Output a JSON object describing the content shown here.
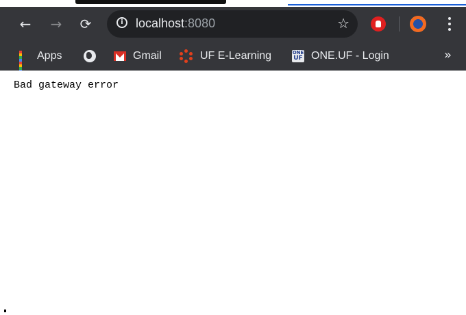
{
  "browser": {
    "address_bar": {
      "host": "localhost",
      "port": ":8080"
    },
    "icons": {
      "back": "back-arrow-icon",
      "forward": "forward-arrow-icon",
      "reload": "reload-icon",
      "info": "info-icon",
      "bookmark_star": "star-icon",
      "extension": "stop-hand-icon",
      "profile": "profile-avatar-icon",
      "menu": "kebab-menu-icon"
    },
    "bookmarks": {
      "items": [
        {
          "label": "Apps",
          "icon": "apps-grid-icon"
        },
        {
          "label": "",
          "icon": "globe-icon"
        },
        {
          "label": "Gmail",
          "icon": "gmail-icon"
        },
        {
          "label": "UF E-Learning",
          "icon": "canvas-icon"
        },
        {
          "label": "ONE.UF - Login",
          "icon": "one-uf-icon"
        }
      ],
      "overflow": "»",
      "oneuf_icon_text": [
        "ONE",
        "UF"
      ]
    },
    "colors": {
      "chrome_bg": "#35363a",
      "omnibox_bg": "#202124",
      "text": "#e8eaed"
    }
  },
  "page": {
    "message": "Bad gateway error"
  }
}
